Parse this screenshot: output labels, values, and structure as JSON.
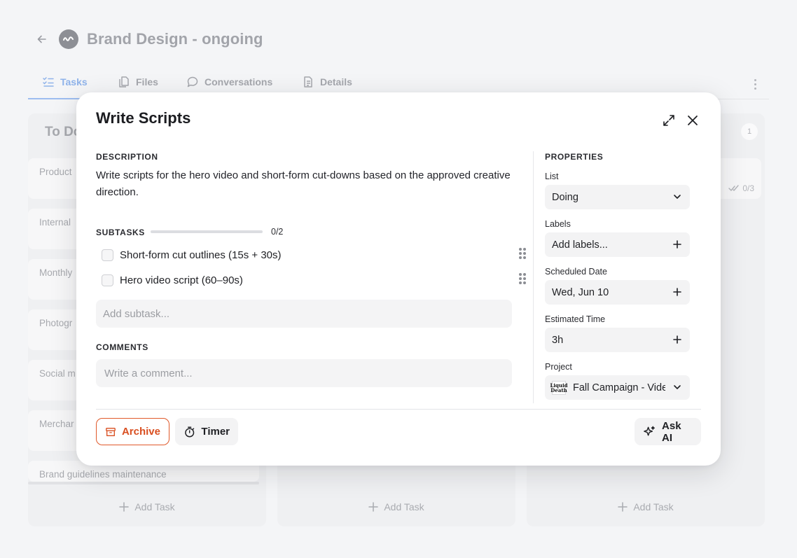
{
  "header": {
    "project_title": "Brand Design - ongoing"
  },
  "tabs": [
    {
      "label": "Tasks",
      "icon": "tasks-icon",
      "active": true
    },
    {
      "label": "Files",
      "icon": "files-icon",
      "active": false
    },
    {
      "label": "Conversations",
      "icon": "chat-icon",
      "active": false
    },
    {
      "label": "Details",
      "icon": "details-icon",
      "active": false
    }
  ],
  "board": {
    "columns": [
      {
        "title": "To Do",
        "cards": [
          "Product",
          "Internal",
          "Monthly",
          "Photogr",
          "Social m",
          "Merchar",
          "Brand guidelines maintenance"
        ],
        "add_task": "Add Task"
      },
      {
        "title": "",
        "cards": [],
        "add_task": "Add Task"
      },
      {
        "title": "",
        "count": "1",
        "card_meta": "0/3",
        "cards": [],
        "add_task": "Add Task"
      }
    ]
  },
  "modal": {
    "title": "Write Scripts",
    "description_label": "DESCRIPTION",
    "description": "Write scripts for the hero video and short-form cut-downs based on the approved creative direction.",
    "subtasks_label": "SUBTASKS",
    "subtasks_progress_text": "0/2",
    "subtasks_progress": 0,
    "subtasks": [
      {
        "label": "Short-form cut outlines (15s + 30s)",
        "checked": false
      },
      {
        "label": "Hero video script (60–90s)",
        "checked": false
      }
    ],
    "add_subtask_placeholder": "Add subtask...",
    "comments_label": "COMMENTS",
    "comment_placeholder": "Write a comment...",
    "properties": {
      "label": "PROPERTIES",
      "list_label": "List",
      "list_value": "Doing",
      "labels_label": "Labels",
      "labels_value": "Add labels...",
      "scheduled_label": "Scheduled Date",
      "scheduled_value": "Wed, Jun 10",
      "estimate_label": "Estimated Time",
      "estimate_value": "3h",
      "project_label": "Project",
      "project_value": "Fall Campaign - Video",
      "project_thumb_text": "Liquid Death"
    },
    "footer": {
      "archive_label": "Archive",
      "timer_label": "Timer",
      "ask_ai_label": "Ask AI"
    }
  },
  "colors": {
    "accent": "#9dbdf0",
    "archive": "#d94f21",
    "text": "#1f2024"
  }
}
